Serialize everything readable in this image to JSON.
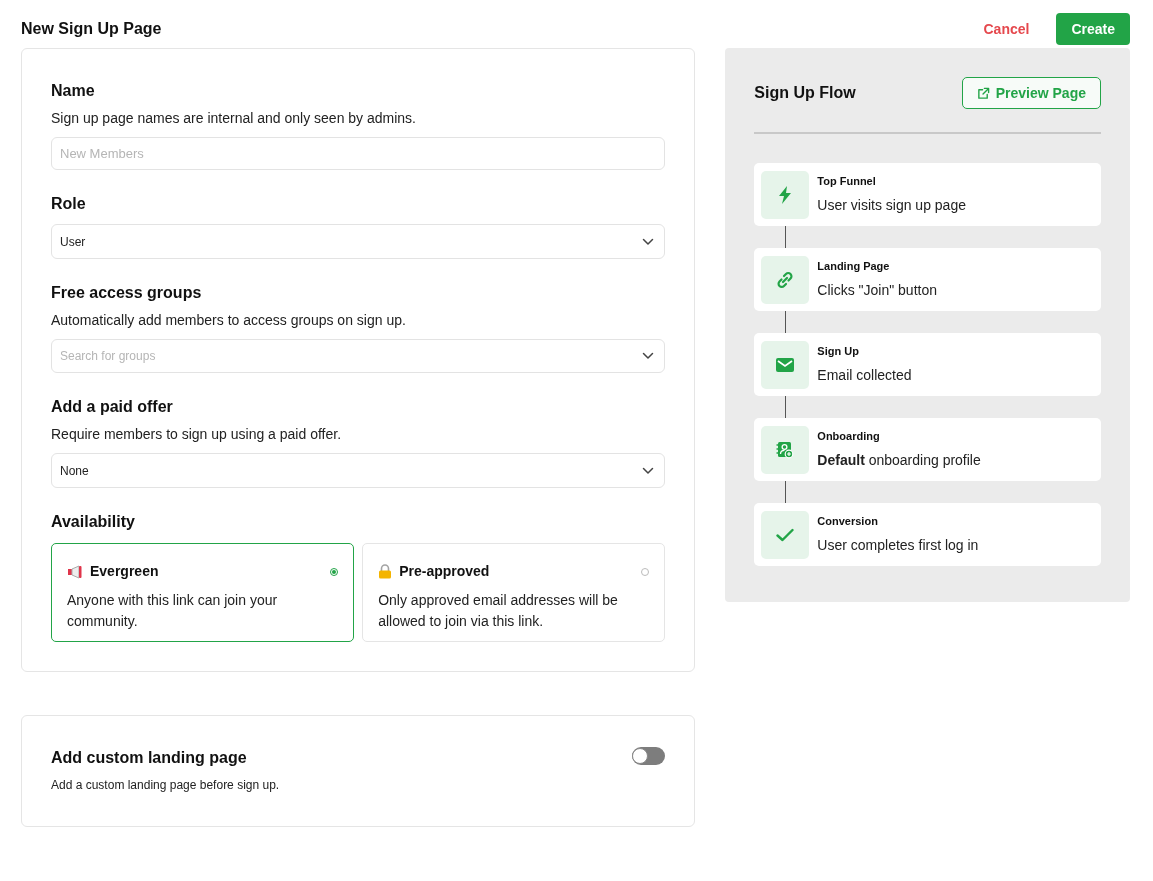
{
  "page": {
    "title": "New Sign Up Page",
    "actions": [
      {
        "kind": "text",
        "label": "Cancel"
      },
      {
        "kind": "primary",
        "label": "Create"
      }
    ]
  },
  "form": {
    "fields": [
      {
        "label": "Name",
        "description": "Sign up page names are internal and only seen by admins.",
        "kind": "input",
        "placeholder": "New Members"
      },
      {
        "label": "Role",
        "kind": "select",
        "value": "User"
      },
      {
        "label": "Free access groups",
        "description": "Automatically add members to access groups on sign up.",
        "kind": "search-select",
        "placeholder": "Search for groups"
      },
      {
        "label": "Add a paid offer",
        "description": "Require members to sign up using a paid offer.",
        "kind": "select",
        "value": "None"
      }
    ],
    "availability": {
      "label": "Availability",
      "options": [
        {
          "kind": "evergreen",
          "title": "Evergreen",
          "description": "Anyone with this link can join your community.",
          "selected": true
        },
        {
          "kind": "restricted",
          "title": "Pre-approved",
          "description": "Only approved email addresses will be allowed to join via this link.",
          "selected": false
        }
      ]
    }
  },
  "landing": {
    "title": "Add custom landing page",
    "description": "Add a custom landing page before sign up.",
    "on": false
  },
  "flow": {
    "title": "Sign Up Flow",
    "preview_button": "Preview Page",
    "steps": [
      {
        "kind": "funnel",
        "title": "Top Funnel",
        "description": "User visits sign up page"
      },
      {
        "kind": "landing",
        "title": "Landing Page",
        "description": "Clicks \"Join\" button"
      },
      {
        "kind": "signup",
        "title": "Sign Up",
        "description": "Email collected"
      },
      {
        "kind": "onboarding",
        "title": "Onboarding",
        "description": "**Default** onboarding profile"
      },
      {
        "kind": "conversion",
        "title": "Conversion",
        "description": "User completes first log in"
      }
    ]
  }
}
